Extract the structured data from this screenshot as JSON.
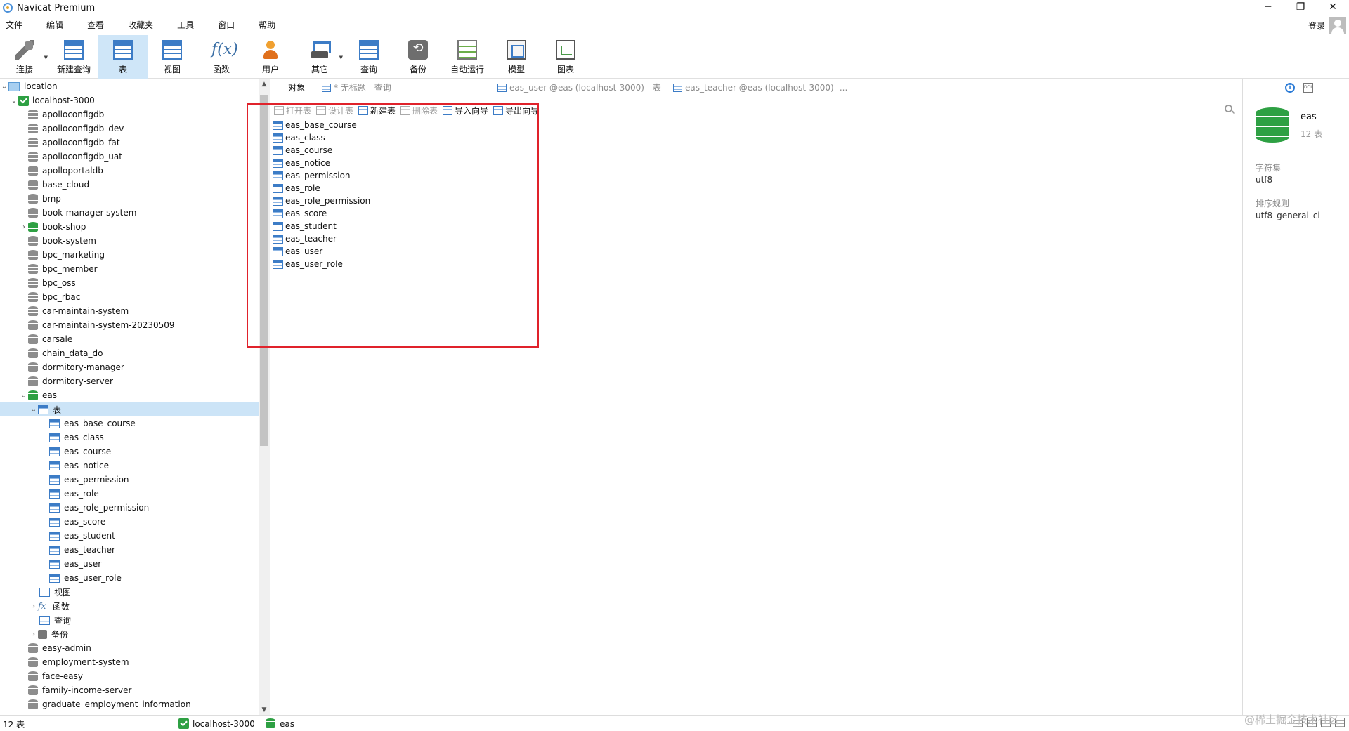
{
  "window": {
    "title": "Navicat Premium",
    "controls": [
      "─",
      "❐",
      "✕"
    ]
  },
  "menu": [
    "文件",
    "编辑",
    "查看",
    "收藏夹",
    "工具",
    "窗口",
    "帮助"
  ],
  "account": {
    "login_label": "登录"
  },
  "toolbar": [
    {
      "label": "连接",
      "icon": "connection-icon"
    },
    {
      "label": "新建查询",
      "icon": "new-query-icon"
    },
    {
      "label": "表",
      "icon": "table-icon",
      "active": true
    },
    {
      "label": "视图",
      "icon": "view-icon"
    },
    {
      "label": "函数",
      "icon": "function-icon"
    },
    {
      "label": "用户",
      "icon": "user-icon"
    },
    {
      "label": "其它",
      "icon": "tools-icon"
    },
    {
      "label": "查询",
      "icon": "query-icon"
    },
    {
      "label": "备份",
      "icon": "backup-icon"
    },
    {
      "label": "自动运行",
      "icon": "auto-run-icon"
    },
    {
      "label": "模型",
      "icon": "model-icon"
    },
    {
      "label": "图表",
      "icon": "chart-icon"
    }
  ],
  "sidebar": {
    "root": "location",
    "connection": "localhost-3000",
    "databases_before": [
      "apolloconfigdb",
      "apolloconfigdb_dev",
      "apolloconfigdb_fat",
      "apolloconfigdb_uat",
      "apolloportaldb",
      "base_cloud",
      "bmp",
      "book-manager-system",
      "book-shop",
      "book-system",
      "bpc_marketing",
      "bpc_member",
      "bpc_oss",
      "bpc_rbac",
      "car-maintain-system",
      "car-maintain-system-20230509",
      "carsale",
      "chain_data_do",
      "dormitory-manager",
      "dormitory-server"
    ],
    "open_db": "eas",
    "tables_node": "表",
    "tables": [
      "eas_base_course",
      "eas_class",
      "eas_course",
      "eas_notice",
      "eas_permission",
      "eas_role",
      "eas_role_permission",
      "eas_score",
      "eas_student",
      "eas_teacher",
      "eas_user",
      "eas_user_role"
    ],
    "other_nodes": [
      "视图",
      "函数",
      "查询",
      "备份"
    ],
    "databases_after": [
      "easy-admin",
      "employment-system",
      "face-easy",
      "family-income-server",
      "graduate_employment_information"
    ]
  },
  "tabs": [
    {
      "label": "对象",
      "active": true
    },
    {
      "label": "* 无标题 - 查询"
    },
    {
      "label": "eas_user @eas (localhost-3000) - 表"
    },
    {
      "label": "eas_teacher @eas (localhost-3000) -..."
    }
  ],
  "object_toolbar": [
    {
      "label": "打开表",
      "disabled": true
    },
    {
      "label": "设计表",
      "disabled": true
    },
    {
      "label": "新建表",
      "disabled": false
    },
    {
      "label": "删除表",
      "disabled": true
    },
    {
      "label": "导入向导",
      "disabled": false
    },
    {
      "label": "导出向导",
      "disabled": false
    }
  ],
  "object_list": [
    "eas_base_course",
    "eas_class",
    "eas_course",
    "eas_notice",
    "eas_permission",
    "eas_role",
    "eas_role_permission",
    "eas_score",
    "eas_student",
    "eas_teacher",
    "eas_user",
    "eas_user_role"
  ],
  "info_panel": {
    "name": "eas",
    "count": "12 表",
    "charset_label": "字符集",
    "charset": "utf8",
    "collation_label": "排序规则",
    "collation": "utf8_general_ci"
  },
  "status": {
    "count": "12 表",
    "connection": "localhost-3000",
    "database": "eas"
  },
  "watermark": "@稀土掘金技术社区",
  "colors": {
    "accent": "#3c7cc6",
    "selection": "#cce4f7",
    "highlight_box": "#e0222b",
    "db_open": "#2ea043"
  }
}
